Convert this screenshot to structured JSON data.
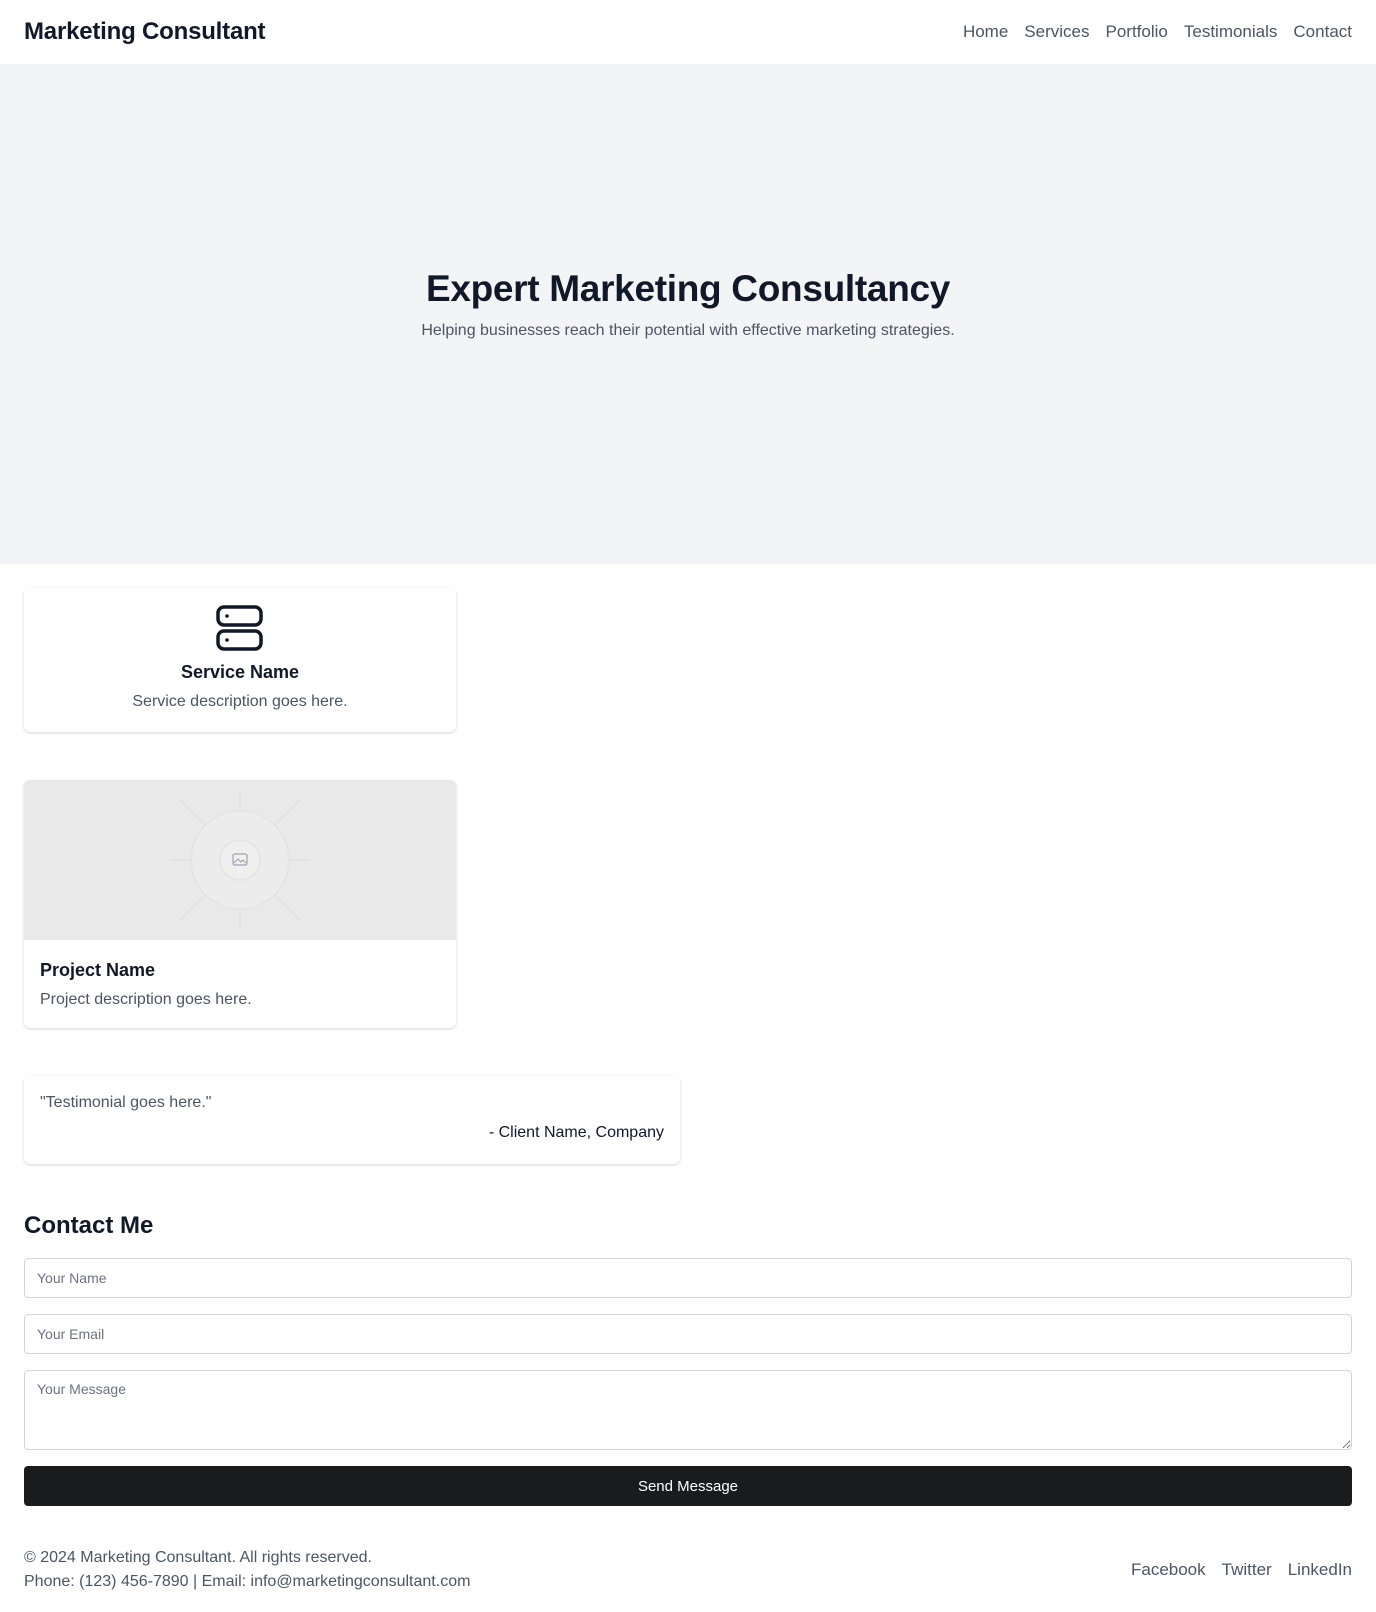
{
  "header": {
    "logo": "Marketing Consultant",
    "nav": [
      "Home",
      "Services",
      "Portfolio",
      "Testimonials",
      "Contact"
    ]
  },
  "hero": {
    "title": "Expert Marketing Consultancy",
    "subtitle": "Helping businesses reach their potential with effective marketing strategies."
  },
  "service": {
    "icon": "server-icon",
    "title": "Service Name",
    "description": "Service description goes here."
  },
  "project": {
    "image_icon": "image-placeholder-icon",
    "title": "Project Name",
    "description": "Project description goes here."
  },
  "testimonial": {
    "quote": "\"Testimonial goes here.\"",
    "author": "- Client Name, Company"
  },
  "contact": {
    "title": "Contact Me",
    "name_placeholder": "Your Name",
    "email_placeholder": "Your Email",
    "message_placeholder": "Your Message",
    "submit_label": "Send Message"
  },
  "footer": {
    "copyright": "© 2024 Marketing Consultant. All rights reserved.",
    "contact_line": "Phone: (123) 456-7890 | Email: info@marketingconsultant.com",
    "links": [
      "Facebook",
      "Twitter",
      "LinkedIn"
    ]
  },
  "colors": {
    "hero_bg": "#f3f4f6",
    "button_bg": "#1a1b1d",
    "text_primary": "#111827",
    "text_muted": "#4b5563"
  }
}
